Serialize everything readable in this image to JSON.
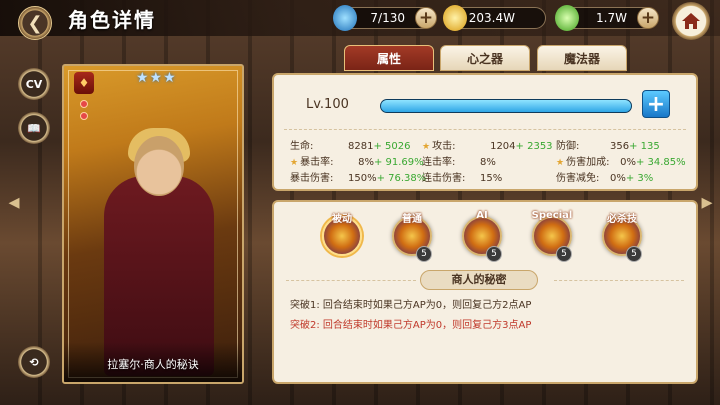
{
  "header": {
    "title": "角色详情"
  },
  "resources": [
    {
      "name": "gem",
      "value": "7/130",
      "color": "#3a9bd8"
    },
    {
      "name": "gold",
      "value": "203.4W",
      "color": "#e8b420"
    },
    {
      "name": "crystal",
      "value": "1.7W",
      "color": "#6fd03a"
    }
  ],
  "side": {
    "cv_label": "CV"
  },
  "card": {
    "name": "拉塞尔·商人的秘诀",
    "stars": "★★★"
  },
  "tabs": [
    "属性",
    "心之器",
    "魔法器"
  ],
  "level": {
    "label": "Lv.100",
    "exp_fraction": 1.0
  },
  "stats": [
    {
      "label": "生命:",
      "value": "8281",
      "bonus": "+ 5026",
      "star": false
    },
    {
      "label": "攻击:",
      "value": "1204",
      "bonus": "+ 2353",
      "star": true
    },
    {
      "label": "防御:",
      "value": "356",
      "bonus": "+ 135",
      "star": false
    },
    {
      "label": "暴击率:",
      "value": "8%",
      "bonus": "+ 91.69%",
      "star": true
    },
    {
      "label": "连击率:",
      "value": "8%",
      "bonus": "",
      "star": false
    },
    {
      "label": "伤害加成:",
      "value": "0%",
      "bonus": "+ 34.85%",
      "star": true
    },
    {
      "label": "暴击伤害:",
      "value": "150%",
      "bonus": "+ 76.38%",
      "star": false
    },
    {
      "label": "连击伤害:",
      "value": "15%",
      "bonus": "",
      "star": false
    },
    {
      "label": "伤害减免:",
      "value": "0%",
      "bonus": "+ 3%",
      "star": false
    }
  ],
  "skills": [
    {
      "name": "被动",
      "level": ""
    },
    {
      "name": "普通",
      "level": "5"
    },
    {
      "name": "AI",
      "level": "5"
    },
    {
      "name": "Special",
      "level": "5"
    },
    {
      "name": "必杀技",
      "level": "5"
    }
  ],
  "secret": {
    "title": "商人的秘密",
    "breaks": [
      {
        "label": "突破1:",
        "text": "回合结束时如果己方AP为0，则回复己方2点AP",
        "color": "#4a3422"
      },
      {
        "label": "突破2:",
        "text": "回合结束时如果己方AP为0，则回复己方3点AP",
        "color": "#c0392b"
      }
    ]
  }
}
